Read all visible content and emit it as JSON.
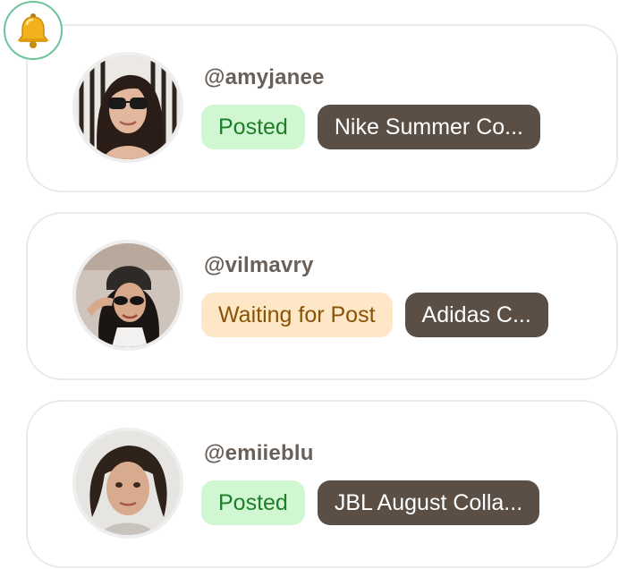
{
  "notification": {
    "icon": "bell-icon"
  },
  "colors": {
    "posted_bg": "#d0f7d2",
    "posted_text": "#1f7d2a",
    "waiting_bg": "#fde7c6",
    "waiting_text": "#8a5206",
    "campaign_bg": "#5a4e45",
    "campaign_text": "#ffffff",
    "badge_border": "#6cc59a"
  },
  "creators": [
    {
      "handle": "@amyjanee",
      "status": "Posted",
      "campaign": "Nike Summer Co..."
    },
    {
      "handle": "@vilmavry",
      "status": "Waiting for Post",
      "campaign": "Adidas C..."
    },
    {
      "handle": "@emiieblu",
      "status": "Posted",
      "campaign": "JBL August Colla..."
    }
  ]
}
